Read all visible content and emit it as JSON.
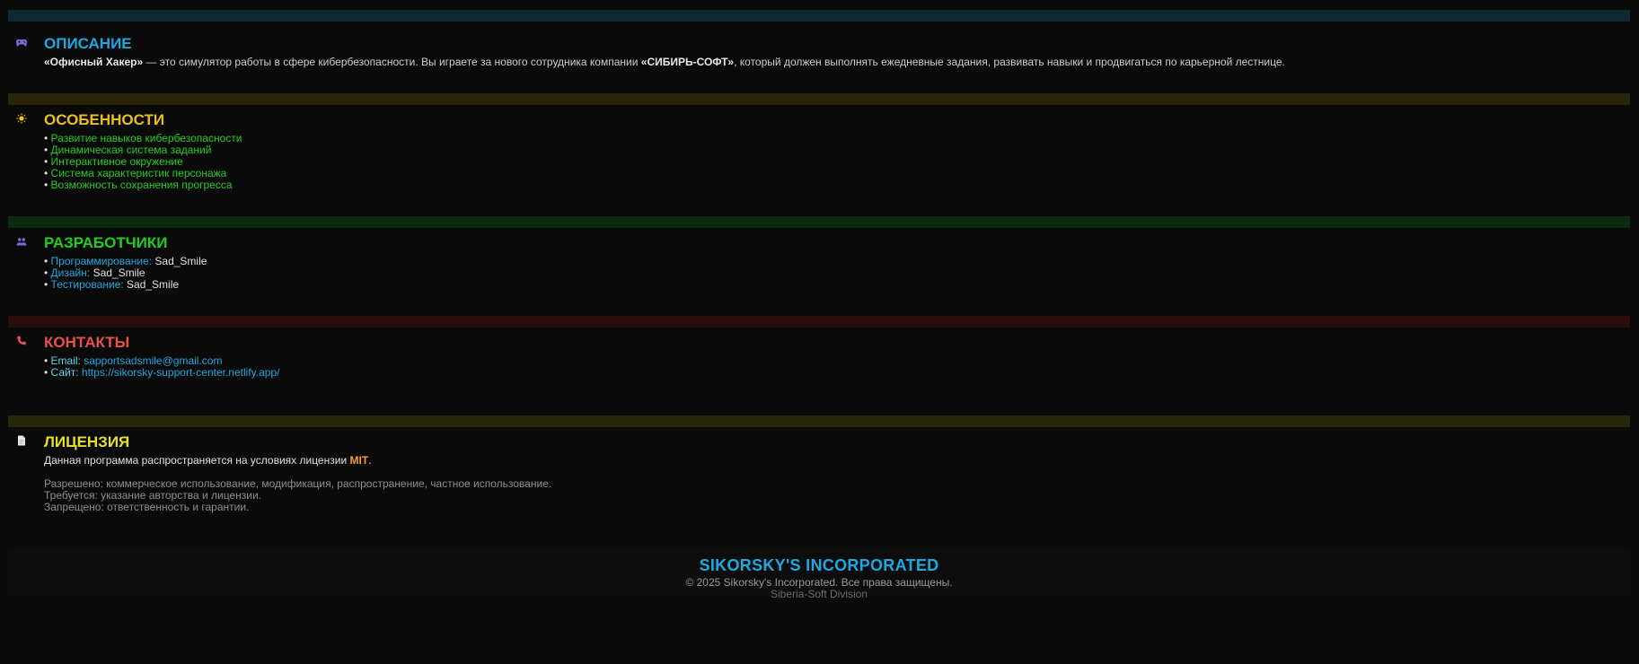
{
  "colors": {
    "blue": "#1ea8e0",
    "yellow": "#e8c020",
    "green": "#22cc22",
    "red": "#e8504a",
    "lime_yellow": "#e8e020",
    "orange": "#f0a030",
    "bar_blue": "#0d2a33",
    "bar_yellow": "#2a2508",
    "bar_green": "#0b2b10",
    "bar_red": "#2a0c0a",
    "bar_lime": "#262608"
  },
  "description": {
    "icon": "gamepad-icon",
    "title": "ОПИСАНИЕ",
    "game_name": "«Офисный Хакер»",
    "text1": " — это симулятор работы в сфере кибербезопасности. Вы играете за нового сотрудника компании ",
    "company": "«СИБИРЬ-СОФТ»",
    "text2": ", который должен выполнять ежедневные задания, развивать навыки и продвигаться по карьерной лестнице."
  },
  "features": {
    "icon": "sparkle-icon",
    "title": "ОСОБЕННОСТИ",
    "bullet": "•",
    "items": [
      "Развитие навыков кибербезопасности",
      "Динамическая система заданий",
      "Интерактивное окружение",
      "Система характеристик персонажа",
      "Возможность сохранения прогресса"
    ]
  },
  "developers": {
    "icon": "people-icon",
    "title": "РАЗРАБОТЧИКИ",
    "items": [
      {
        "role": "Программирование:",
        "name": "Sad_Smile"
      },
      {
        "role": "Дизайн:",
        "name": "Sad_Smile"
      },
      {
        "role": "Тестирование:",
        "name": "Sad_Smile"
      }
    ]
  },
  "contacts": {
    "icon": "phone-icon",
    "title": "КОНТАКТЫ",
    "email_label": "Email:",
    "email": "sapportsadsmile@gmail.com",
    "site_label": "Сайт:",
    "site": "https://sikorsky-support-center.netlify.app/"
  },
  "license": {
    "icon": "document-icon",
    "title": "ЛИЦЕНЗИЯ",
    "text1": "Данная программа распространяется на условиях лицензии ",
    "license_name": "MIT",
    "text2": ".",
    "allowed": "Разрешено: коммерческое использование, модификация, распространение, частное использование.",
    "required": "Требуется: указание авторства и лицензии.",
    "forbidden": "Запрещено: ответственность и гарантии."
  },
  "footer": {
    "brand": "SIKORSKY'S INCORPORATED",
    "copyright": "© 2025 Sikorsky's Incorporated. Все права защищены.",
    "division": "Siberia-Soft Division"
  }
}
